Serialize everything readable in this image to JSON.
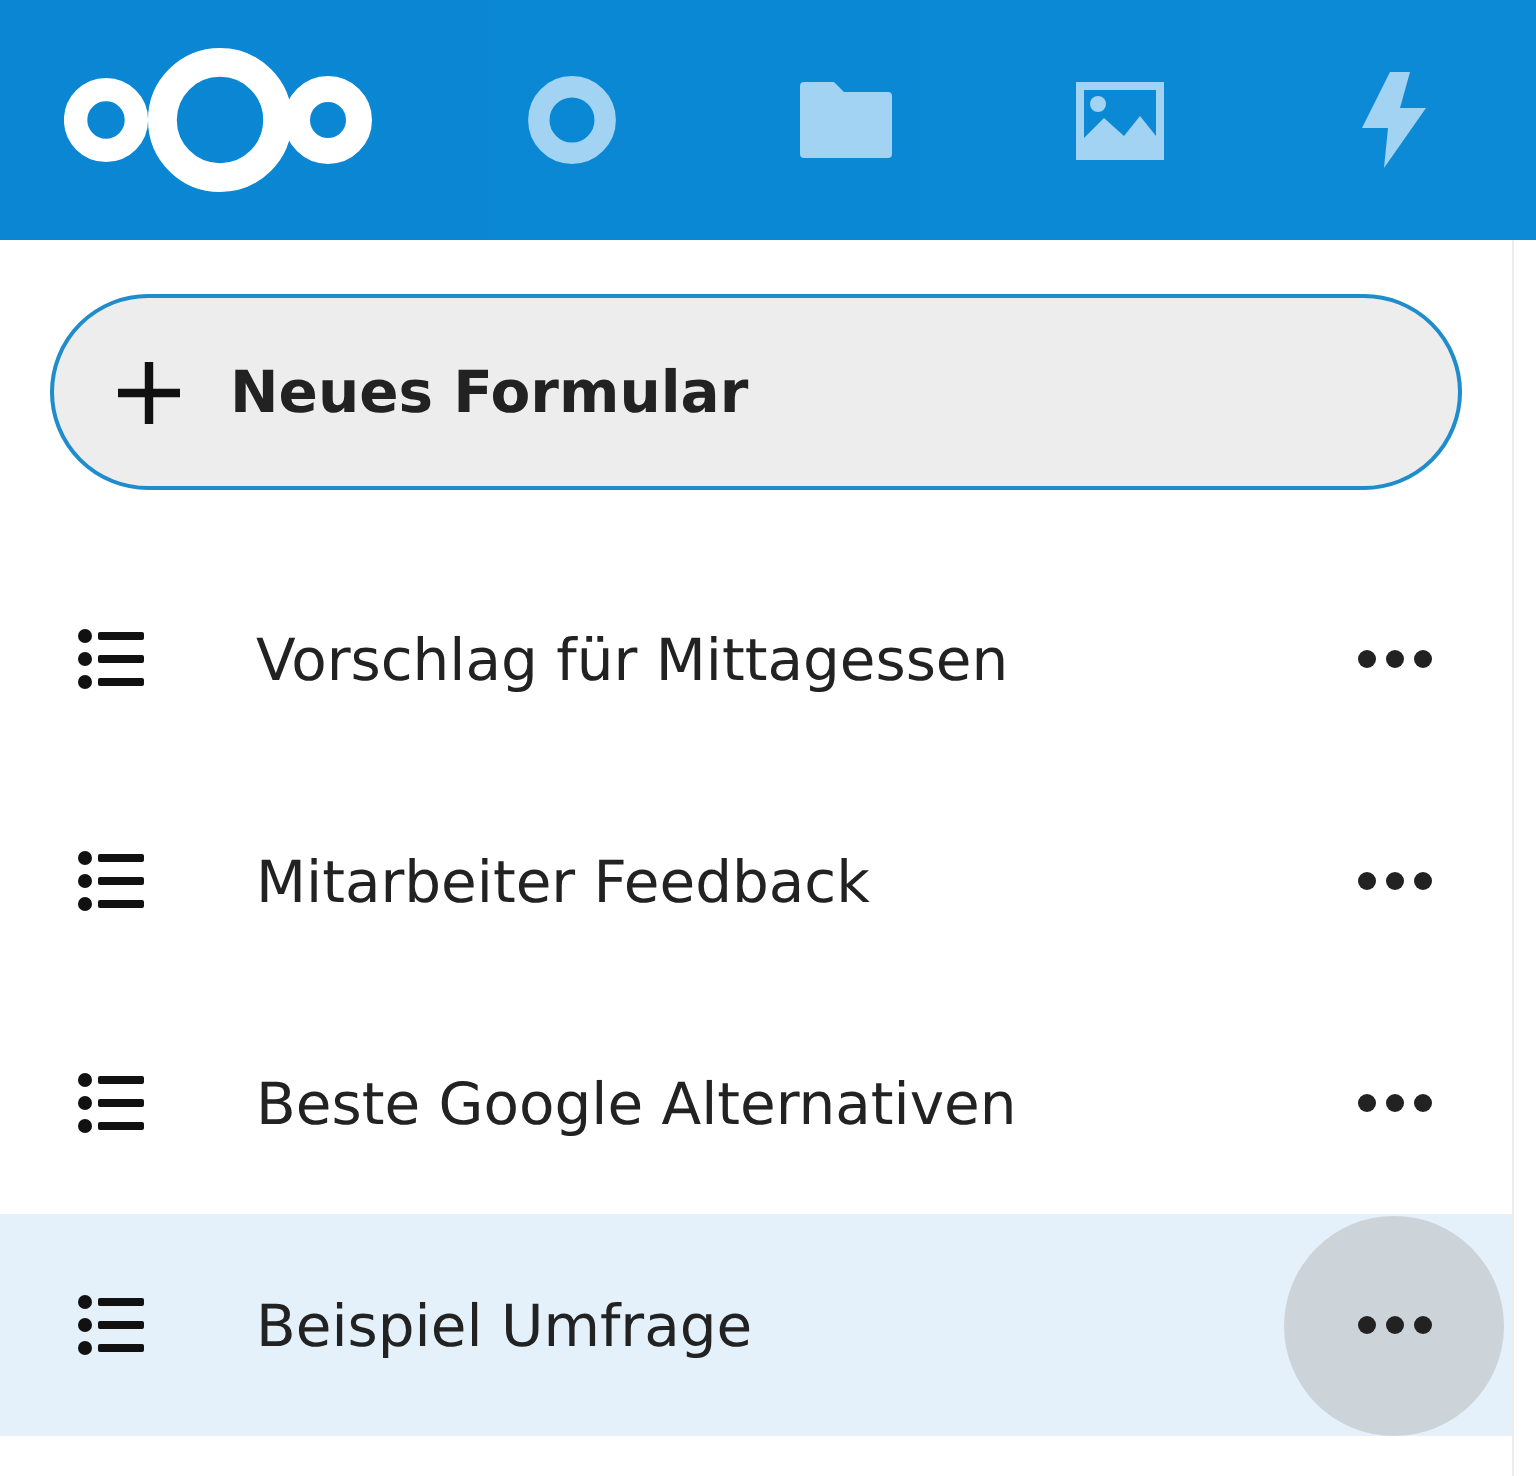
{
  "header": {
    "apps": [
      {
        "kind": "dashboard",
        "selected": false
      },
      {
        "kind": "files",
        "selected": false
      },
      {
        "kind": "photos",
        "selected": false
      },
      {
        "kind": "activity",
        "selected": false
      }
    ]
  },
  "new_form_button": {
    "label": "Neues Formular"
  },
  "forms": [
    {
      "title": "Vorschlag für Mittagessen",
      "selected": false,
      "menu_highlighted": false
    },
    {
      "title": "Mitarbeiter Feedback",
      "selected": false,
      "menu_highlighted": false
    },
    {
      "title": "Beste Google Alternativen",
      "selected": false,
      "menu_highlighted": false
    },
    {
      "title": "Beispiel Umfrage",
      "selected": true,
      "menu_highlighted": true
    }
  ]
}
